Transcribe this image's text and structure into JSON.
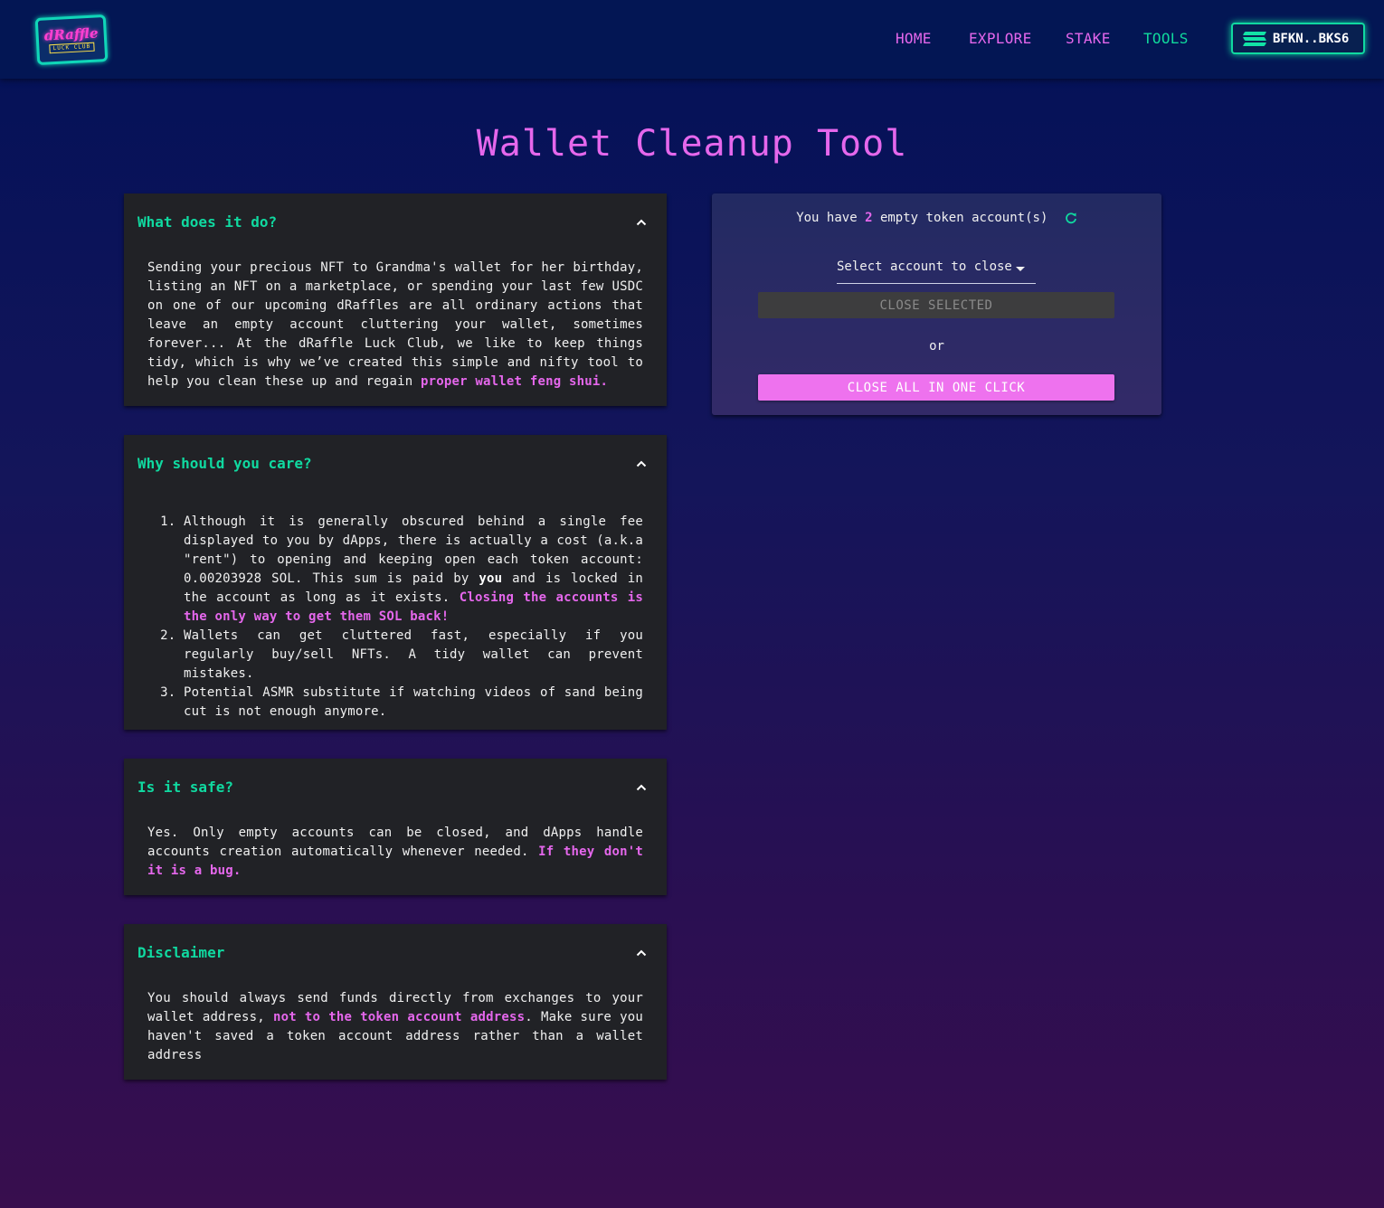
{
  "header": {
    "logo_text": "dRaffle",
    "logo_sub": "LUCK CLUB",
    "nav": {
      "home": "HOME",
      "explore": "EXPLORE",
      "stake": "STAKE",
      "tools": "TOOLS"
    },
    "wallet": {
      "address": "BFKN..BKS6",
      "icon": "solana-icon"
    },
    "colors": {
      "nav_inactive": "#e567ec",
      "nav_active": "#10d99c",
      "accent_glow": "#10d9a0"
    }
  },
  "page": {
    "title": "Wallet Cleanup Tool"
  },
  "faq": {
    "what": {
      "title": "What does it do?",
      "body": "Sending your precious NFT to Grandma's wallet for her birthday, listing an NFT on a marketplace, or spending your last few USDC on one of our upcoming dRaffles are all ordinary actions that leave an empty account cluttering your wallet, sometimes forever... At the dRaffle Luck Club, we like to keep things tidy, which is why we’ve created this simple and nifty tool to help you clean these up and regain ",
      "highlight": "proper wallet feng shui."
    },
    "why": {
      "title": "Why should you care?",
      "item1_a": "Although it is generally obscured behind a single fee displayed to you by dApps, there is actually a cost (a.k.a \"rent\") to opening and keeping open each token account: 0.00203928 SOL. This sum is paid by ",
      "item1_bold": "you",
      "item1_b": " and is locked in the account as long as it exists. ",
      "item1_highlight": "Closing the accounts is the only way to get them SOL back!",
      "item2": "Wallets can get cluttered fast, especially if you regularly buy/sell NFTs. A tidy wallet can prevent mistakes.",
      "item3": "Potential ASMR substitute if watching videos of sand being cut is not enough anymore."
    },
    "safe": {
      "title": "Is it safe?",
      "body": "Yes. Only empty accounts can be closed, and dApps handle accounts creation automatically whenever needed. ",
      "highlight": "If they don't it is a bug."
    },
    "disclaimer": {
      "title": "Disclaimer",
      "body_a": "You should always send funds directly from exchanges to your wallet address, ",
      "highlight": "not to the token account address",
      "body_b": ". Make sure you haven't saved a token account address rather than a wallet address"
    }
  },
  "cleanup": {
    "count_prefix": "You have",
    "count": "2",
    "count_suffix": "empty token account(s)",
    "select_placeholder": "Select account to close",
    "close_selected": "CLOSE SELECTED",
    "or": "or",
    "close_all": "CLOSE ALL IN ONE CLICK",
    "colors": {
      "primary_button": "#ee72ee",
      "disabled_button": "#3d3d3e",
      "count_highlight": "#e567ec"
    }
  }
}
